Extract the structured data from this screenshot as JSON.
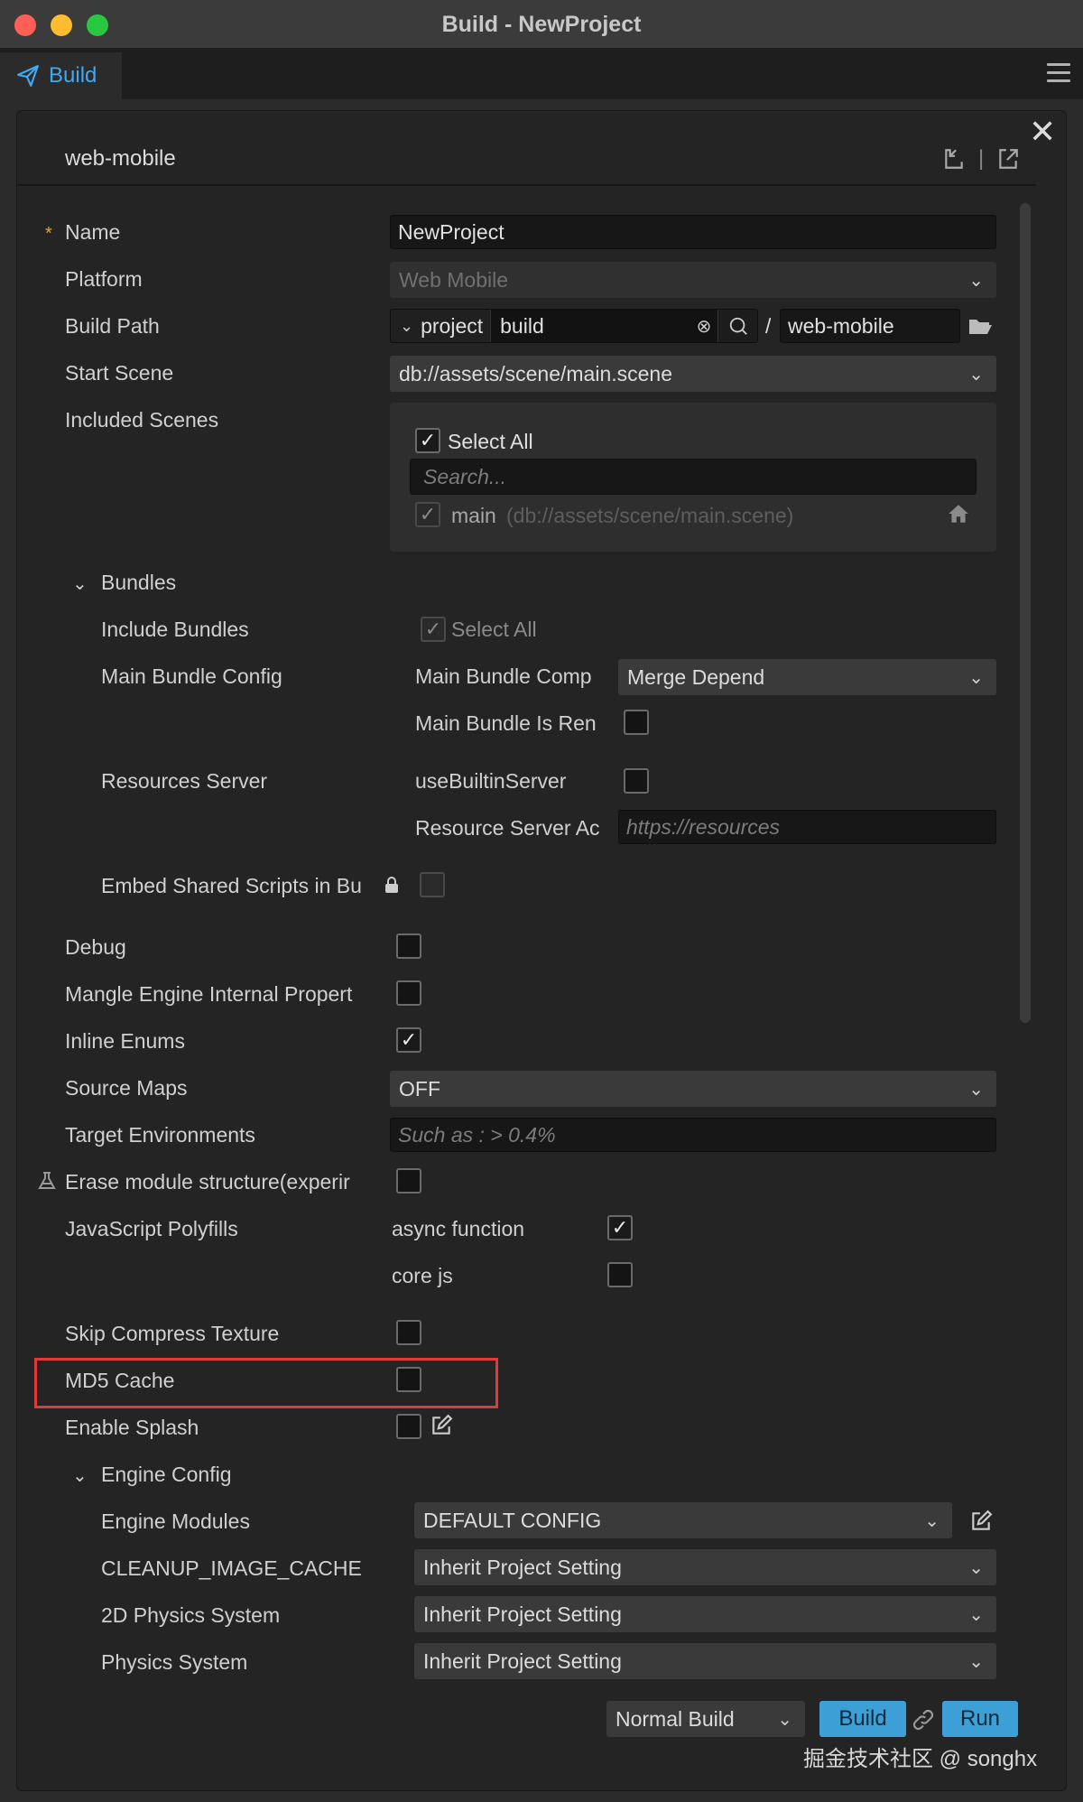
{
  "window": {
    "title": "Build - NewProject"
  },
  "tab": {
    "label": "Build"
  },
  "panel": {
    "platform": "web-mobile"
  },
  "form": {
    "name": {
      "label": "Name",
      "value": "NewProject"
    },
    "platform": {
      "label": "Platform",
      "value": "Web Mobile"
    },
    "build_path": {
      "label": "Build Path",
      "root": "project",
      "dir": "build",
      "sep": "/",
      "sub": "web-mobile"
    },
    "start_scene": {
      "label": "Start Scene",
      "value": "db://assets/scene/main.scene"
    },
    "included_scenes": {
      "label": "Included Scenes",
      "select_all": "Select All",
      "search_placeholder": "Search...",
      "scene_name": "main",
      "scene_path": "(db://assets/scene/main.scene)"
    },
    "bundles": {
      "label": "Bundles",
      "include_label": "Include Bundles",
      "include_select_all": "Select All",
      "main_config_label": "Main Bundle Config",
      "compression_label": "Main Bundle Comp",
      "compression_value": "Merge Depend",
      "is_remote_label": "Main Bundle Is Ren",
      "resources_server_label": "Resources Server",
      "use_builtin_label": "useBuiltinServer",
      "server_addr_label": "Resource Server Ac",
      "server_addr_placeholder": "https://resources",
      "embed_label": "Embed Shared Scripts in Bu"
    },
    "debug": {
      "label": "Debug",
      "checked": false
    },
    "mangle": {
      "label": "Mangle Engine Internal Propert",
      "checked": false
    },
    "inline_enums": {
      "label": "Inline Enums",
      "checked": true
    },
    "source_maps": {
      "label": "Source Maps",
      "value": "OFF"
    },
    "target_env": {
      "label": "Target Environments",
      "placeholder": "Such as : > 0.4%"
    },
    "erase_module": {
      "label": "Erase module structure(experir"
    },
    "polyfills": {
      "label": "JavaScript Polyfills",
      "async_label": "async function",
      "corejs_label": "core js"
    },
    "skip_compress": {
      "label": "Skip Compress Texture"
    },
    "md5_cache": {
      "label": "MD5 Cache"
    },
    "splash": {
      "label": "Enable Splash"
    },
    "engine_config": {
      "label": "Engine Config",
      "modules_label": "Engine Modules",
      "modules_value": "DEFAULT CONFIG",
      "cleanup_label": "CLEANUP_IMAGE_CACHE",
      "cleanup_value": "Inherit Project Setting",
      "physics2d_label": "2D Physics System",
      "physics2d_value": "Inherit Project Setting",
      "physics_label": "Physics System",
      "physics_value": "Inherit Project Setting"
    }
  },
  "footer": {
    "build_mode": "Normal Build",
    "build_button": "Build",
    "run_button": "Run"
  },
  "watermark": "掘金技术社区 @ songhx",
  "colors": {
    "accent": "#3c9fd6",
    "highlight": "#e03a3a",
    "required": "#e6a23c"
  },
  "icons": [
    "send-icon",
    "hamburger-icon",
    "close-icon",
    "import-icon",
    "export-icon",
    "chevron-down-icon",
    "clear-icon",
    "search-icon",
    "folder-icon",
    "home-icon",
    "lock-icon",
    "flask-icon",
    "edit-icon",
    "link-icon"
  ]
}
